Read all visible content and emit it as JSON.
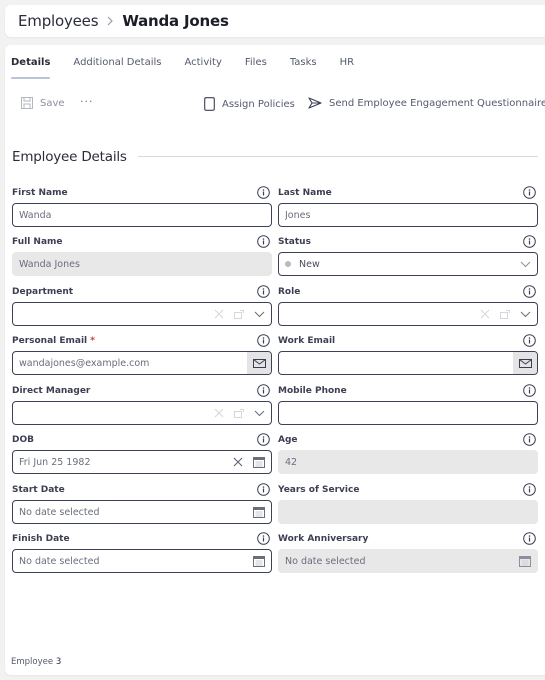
{
  "breadcrumb": {
    "root": "Employees",
    "separator_icon": "chevron-right-icon",
    "current": "Wanda Jones"
  },
  "tabs": [
    {
      "label": "Details",
      "active": true
    },
    {
      "label": "Additional Details",
      "active": false
    },
    {
      "label": "Activity",
      "active": false
    },
    {
      "label": "Files",
      "active": false
    },
    {
      "label": "Tasks",
      "active": false
    },
    {
      "label": "HR",
      "active": false
    }
  ],
  "toolbar": {
    "save_label": "Save",
    "more_label": "···",
    "assign_label": "Assign Policies",
    "send_label": "Send Employee Engagement Questionnaire"
  },
  "section": {
    "title": "Employee Details"
  },
  "fields": {
    "first_name": {
      "label": "First Name",
      "value": "Wanda"
    },
    "last_name": {
      "label": "Last Name",
      "value": "Jones"
    },
    "full_name": {
      "label": "Full Name",
      "value": "Wanda Jones"
    },
    "status": {
      "label": "Status",
      "value": "New"
    },
    "department": {
      "label": "Department",
      "value": ""
    },
    "role": {
      "label": "Role",
      "value": ""
    },
    "personal_email": {
      "label": "Personal Email",
      "required_mark": "*",
      "value": "wandajones@example.com"
    },
    "work_email": {
      "label": "Work Email",
      "value": ""
    },
    "direct_manager": {
      "label": "Direct Manager",
      "value": ""
    },
    "mobile_phone": {
      "label": "Mobile Phone",
      "value": ""
    },
    "dob": {
      "label": "DOB",
      "value": "Fri Jun 25 1982"
    },
    "age": {
      "label": "Age",
      "value": "42"
    },
    "start_date": {
      "label": "Start Date",
      "value": "No date selected"
    },
    "years_of_service": {
      "label": "Years of Service",
      "value": ""
    },
    "finish_date": {
      "label": "Finish Date",
      "value": "No date selected"
    },
    "work_anniversary": {
      "label": "Work Anniversary",
      "value": "No date selected"
    }
  },
  "footer": {
    "label": "Employee",
    "value": "3"
  },
  "colors": {
    "border": "#3c4156",
    "readonly_bg": "#e8e8e9",
    "required": "#c93a3a",
    "tab_indicator": "#b9c2d8"
  }
}
